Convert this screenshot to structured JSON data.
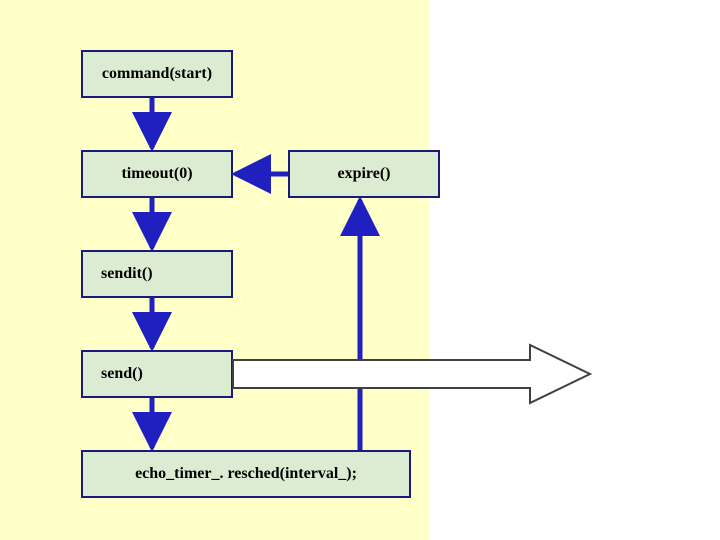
{
  "boxes": {
    "command_start": "command(start)",
    "timeout0": "timeout(0)",
    "expire": "expire()",
    "sendit": "sendit()",
    "send": "send()",
    "resched": "echo_timer_. resched(interval_);"
  }
}
